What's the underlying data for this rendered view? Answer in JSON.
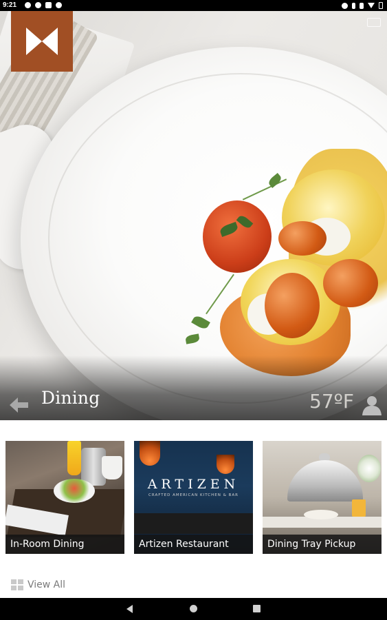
{
  "status_bar": {
    "time": "9:21",
    "left_icons": [
      "notification-icon",
      "notification-icon",
      "image-icon",
      "globe-icon"
    ],
    "right_icons": [
      "alarm-icon",
      "bluetooth-icon",
      "vibrate-icon",
      "wifi-icon",
      "battery-icon"
    ]
  },
  "header": {
    "title": "Dining",
    "temperature": "57ºF"
  },
  "brand": {
    "logo_icon": "bowtie-logo-icon",
    "logo_color": "#A14F24"
  },
  "tiles": [
    {
      "label": "In-Room Dining"
    },
    {
      "label": "Artizen Restaurant",
      "image_brand": "ARTIZEN",
      "image_tagline": "CRAFTED AMERICAN KITCHEN & BAR"
    },
    {
      "label": "Dining Tray Pickup"
    }
  ],
  "footer": {
    "view_all_label": "View All",
    "view_all_icon": "grid-icon"
  },
  "nav_bar": {
    "icons": [
      "back-icon",
      "home-icon",
      "recents-icon"
    ]
  }
}
